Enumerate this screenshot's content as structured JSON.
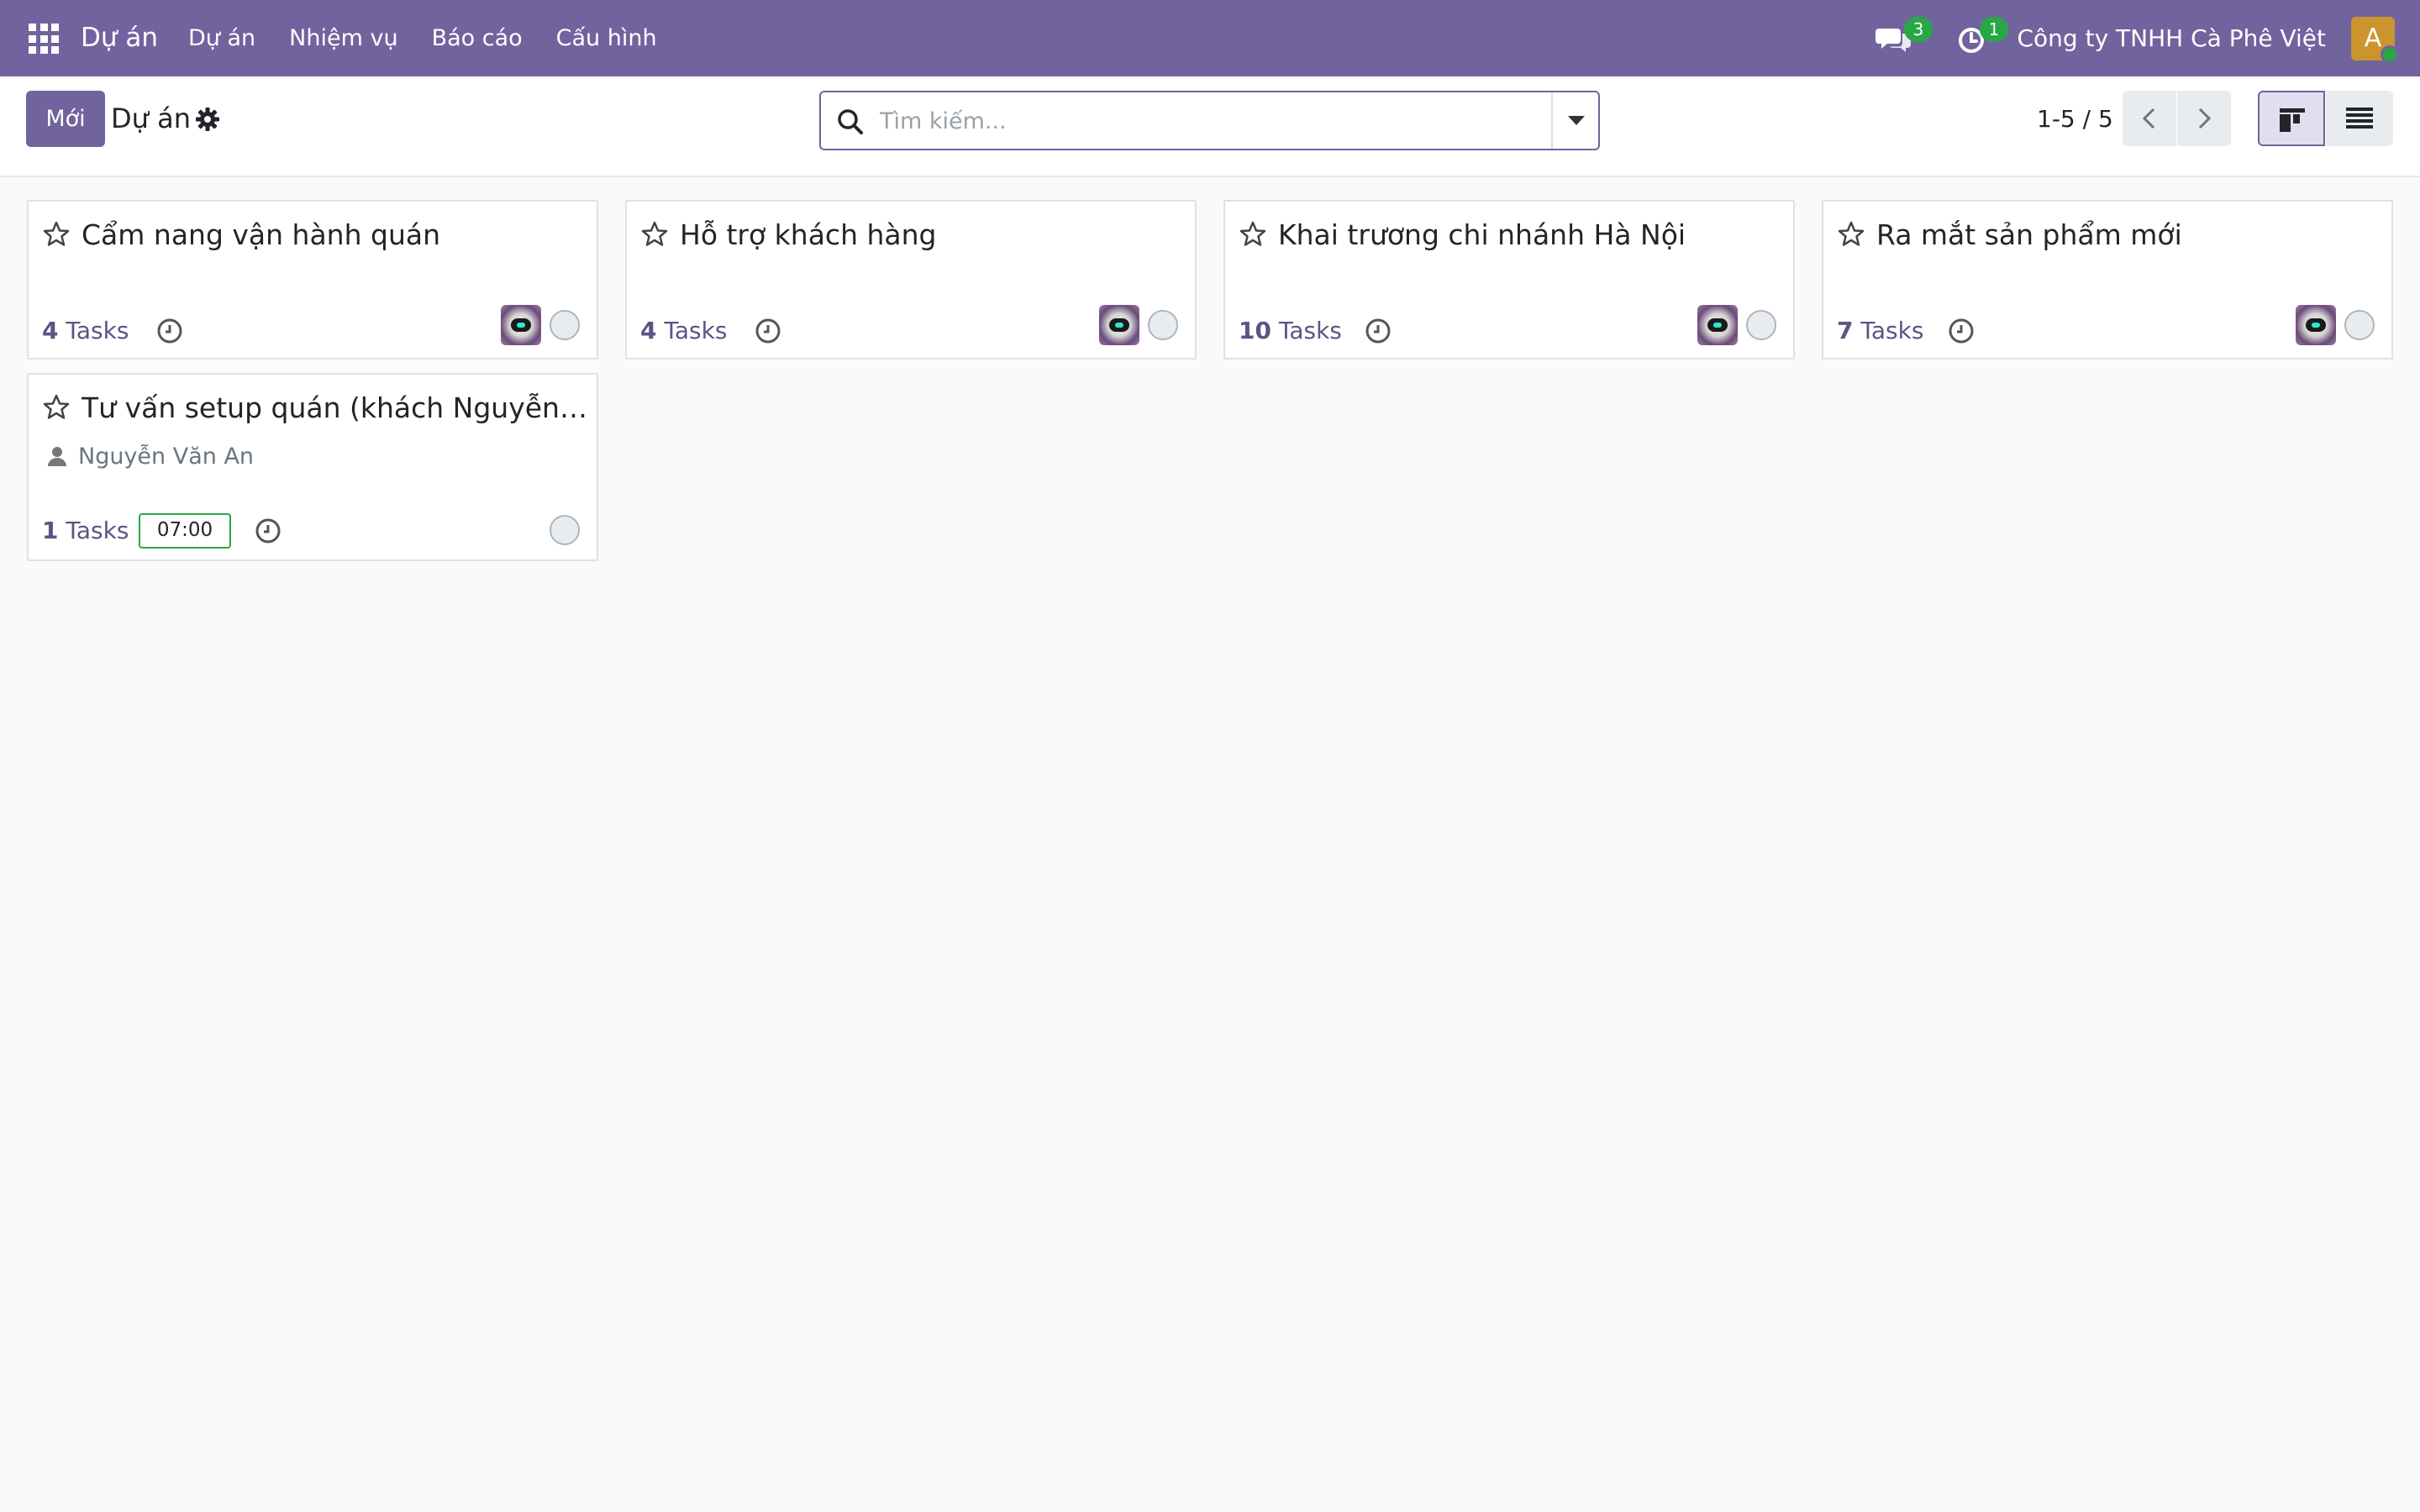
{
  "navbar": {
    "app_name": "Dự án",
    "menu": [
      "Dự án",
      "Nhiệm vụ",
      "Báo cáo",
      "Cấu hình"
    ],
    "messages_count": "3",
    "activities_count": "1",
    "company": "Công ty TNHH Cà Phê Việt",
    "user_initial": "A",
    "colors": {
      "navbar": "#71639e",
      "badge": "#28a745"
    }
  },
  "control": {
    "new_button": "Mới",
    "title": "Dự án",
    "search_placeholder": "Tìm kiếm...",
    "pager": "1-5 / 5"
  },
  "projects": [
    {
      "name": "Cẩm nang vận hành quán",
      "tasks_count": "4",
      "tasks_label": "Tasks"
    },
    {
      "name": "Hỗ trợ khách hàng",
      "tasks_count": "4",
      "tasks_label": "Tasks"
    },
    {
      "name": "Khai trương chi nhánh Hà Nội",
      "tasks_count": "10",
      "tasks_label": "Tasks"
    },
    {
      "name": "Ra mắt sản phẩm mới",
      "tasks_count": "7",
      "tasks_label": "Tasks"
    },
    {
      "name": "Tư vấn setup quán (khách Nguyễn V...",
      "customer": "Nguyễn Văn An",
      "tasks_count": "1",
      "tasks_label": "Tasks",
      "date": "07:00"
    }
  ]
}
